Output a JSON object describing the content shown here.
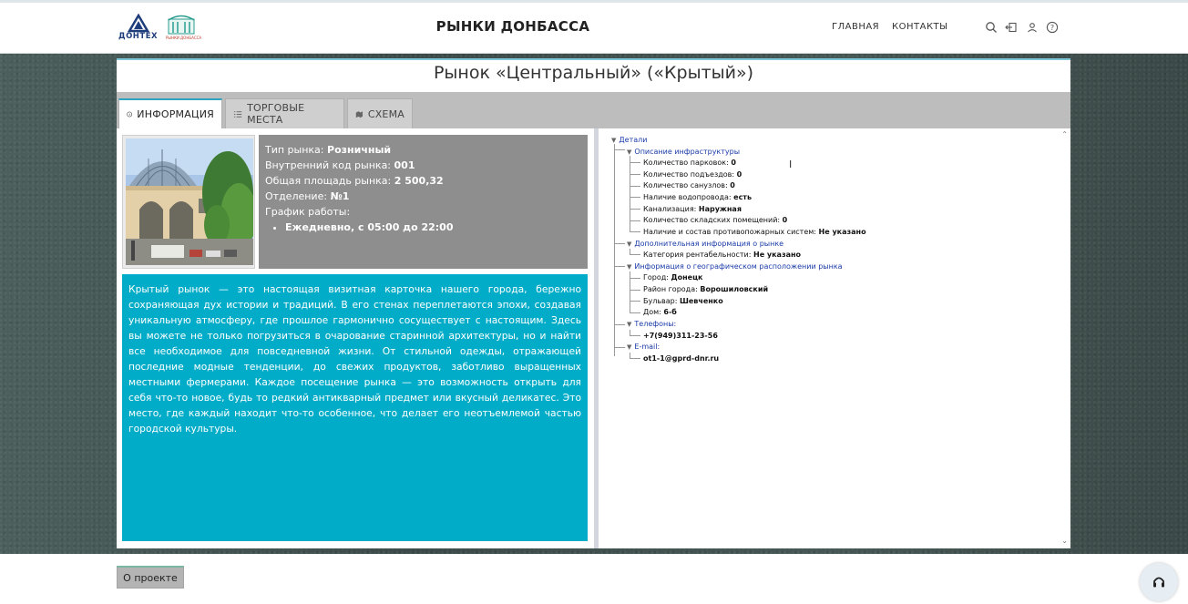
{
  "header": {
    "logo_left_text": "ДОНТЕХ",
    "logo_right_text": "РЫНКИ ДОНБАССА",
    "title": "РЫНКИ ДОНБАССА",
    "nav": [
      "ГЛАВНАЯ",
      "КОНТАКТЫ"
    ],
    "icons": [
      "search-icon",
      "login-icon",
      "user-icon",
      "help-icon"
    ]
  },
  "market": {
    "title": "Рынок «Центральный» («Крытый»)"
  },
  "tabs": [
    {
      "label": "ИНФОРМАЦИЯ",
      "icon": "info-icon",
      "active": true
    },
    {
      "label": "ТОРГОВЫЕ МЕСТА",
      "icon": "list-icon",
      "active": false
    },
    {
      "label": "СХЕМА",
      "icon": "map-icon",
      "active": false
    }
  ],
  "details": {
    "type_label": "Тип рынка: ",
    "type_value": "Розничный",
    "code_label": "Внутренний код рынка: ",
    "code_value": "001",
    "area_label": "Общая площадь рынка: ",
    "area_value": "2 500,32",
    "dept_label": "Отделение: ",
    "dept_value": "№1",
    "schedule_label": "График работы:",
    "schedule_value": "Ежедневно, с 05:00 до 22:00"
  },
  "description": "Крытый рынок — это настоящая визитная карточка нашего города, бережно сохраняющая дух истории и традиций. В его стенах переплетаются эпохи, создавая уникальную атмосферу, где прошлое гармонично сосуществует с настоящим. Здесь вы можете не только погрузиться в очарование старинной архитектуры, но и найти все необходимое для повседневной жизни. От стильной одежды, отражающей последние модные тенденции, до свежих продуктов, заботливо выращенных местными фермерами. Каждое посещение рынка — это возможность открыть для себя что-то новое, будь то редкий антикварный предмет или вкусный деликатес. Это место, где каждый находит что-то особенное, что делает его неотъемлемой частью городской культуры.",
  "tree": {
    "root": "Детали",
    "infra": {
      "title": "Описание инфраструктуры",
      "items": [
        {
          "label": "Количество парковок: ",
          "value": "0"
        },
        {
          "label": "Количество подъездов: ",
          "value": "0"
        },
        {
          "label": "Количество санузлов: ",
          "value": "0"
        },
        {
          "label": "Наличие водопровода: ",
          "value": "есть"
        },
        {
          "label": "Канализация: ",
          "value": "Наружная"
        },
        {
          "label": "Количество складских помещений: ",
          "value": "0"
        },
        {
          "label": "Наличие и состав противопожарных систем: ",
          "value": "Не указано"
        }
      ]
    },
    "extra": {
      "title": "Дополнительная информация о рынке",
      "items": [
        {
          "label": "Категория рентабельности: ",
          "value": "Не указано"
        }
      ]
    },
    "geo": {
      "title": "Информация о географическом расположении рынка",
      "items": [
        {
          "label": "Город: ",
          "value": "Донецк"
        },
        {
          "label": "Район города: ",
          "value": "Ворошиловский"
        },
        {
          "label": "Бульвар: ",
          "value": "Шевченко"
        },
        {
          "label": "Дом: ",
          "value": "6-б"
        }
      ]
    },
    "phones": {
      "title": "Телефоны:",
      "items": [
        "+7(949)311-23-56"
      ]
    },
    "emails": {
      "title": "E-mail:",
      "items": [
        "ot1-1@gprd-dnr.ru"
      ]
    }
  },
  "footer": {
    "about_label": "О проекте",
    "support_icon": "headset-icon"
  }
}
